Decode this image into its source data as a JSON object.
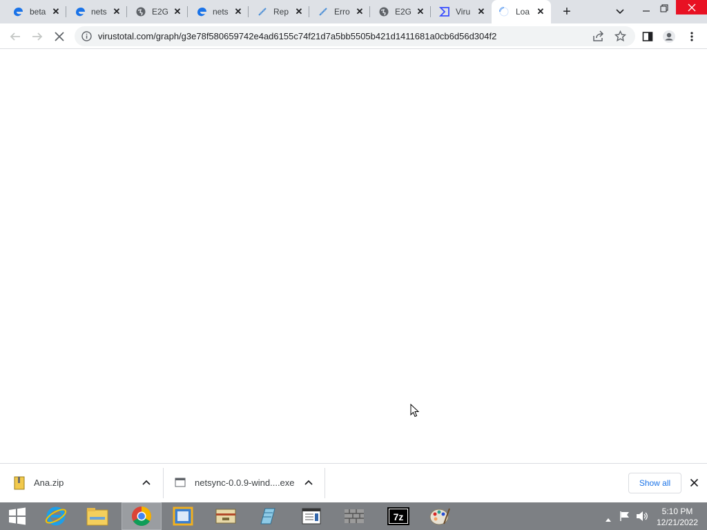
{
  "browser": {
    "tabs": [
      {
        "title": "beta",
        "favicon": "edge-blue-icon"
      },
      {
        "title": "nets",
        "favicon": "edge-blue-icon"
      },
      {
        "title": "E2G",
        "favicon": "globe-icon"
      },
      {
        "title": "nets",
        "favicon": "edge-blue-icon"
      },
      {
        "title": "Rep",
        "favicon": "link-icon"
      },
      {
        "title": "Erro",
        "favicon": "link-icon"
      },
      {
        "title": "E2G",
        "favicon": "globe-icon"
      },
      {
        "title": "Viru",
        "favicon": "virustotal-icon"
      },
      {
        "title": "Loa",
        "favicon": "loading-spinner-icon",
        "active": true
      }
    ],
    "url": "virustotal.com/graph/g3e78f580659742e4ad6155c74f21d7a5bb5505b421d1411681a0cb6d56d304f2",
    "accent": "#1a73e8"
  },
  "downloads": {
    "items": [
      {
        "name": "Ana.zip",
        "icon": "zip-file-icon"
      },
      {
        "name": "netsync-0.0.9-wind....exe",
        "icon": "exe-file-icon"
      }
    ],
    "show_all": "Show all"
  },
  "taskbar": {
    "apps": [
      "internet-explorer-icon",
      "file-explorer-icon",
      "chrome-icon",
      "app-window-icon",
      "archive-icon",
      "notepad-icon",
      "document-viewer-icon",
      "firewall-icon",
      "7zip-icon",
      "paint-icon"
    ],
    "time": "5:10 PM",
    "date": "12/21/2022"
  }
}
